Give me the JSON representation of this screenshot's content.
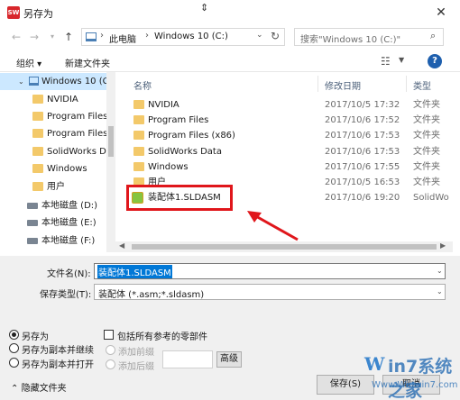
{
  "window": {
    "title": "另存为",
    "app_logo": "SW"
  },
  "nav": {
    "crumbs": [
      "此电脑",
      "Windows 10 (C:)"
    ],
    "search_placeholder": "搜索\"Windows 10 (C:)\""
  },
  "toolbar": {
    "organize": "组织 ▾",
    "new_folder": "新建文件夹"
  },
  "navpane": {
    "root": "Windows 10 (C",
    "items": [
      "NVIDIA",
      "Program Files",
      "Program Files",
      "SolidWorks D",
      "Windows",
      "用户"
    ],
    "drives": [
      "本地磁盘 (D:)",
      "本地磁盘 (E:)",
      "本地磁盘 (F:)"
    ]
  },
  "filelist": {
    "headers": {
      "name": "名称",
      "date": "修改日期",
      "type": "类型"
    },
    "rows": [
      {
        "name": "NVIDIA",
        "date": "2017/10/5 17:32",
        "type": "文件夹"
      },
      {
        "name": "Program Files",
        "date": "2017/10/6 17:52",
        "type": "文件夹"
      },
      {
        "name": "Program Files (x86)",
        "date": "2017/10/6 17:53",
        "type": "文件夹"
      },
      {
        "name": "SolidWorks Data",
        "date": "2017/10/6 17:53",
        "type": "文件夹"
      },
      {
        "name": "Windows",
        "date": "2017/10/6 17:55",
        "type": "文件夹"
      },
      {
        "name": "用户",
        "date": "2017/10/5 16:53",
        "type": "文件夹"
      },
      {
        "name": "装配体1.SLDASM",
        "date": "2017/10/6 19:20",
        "type": "SolidWo"
      }
    ]
  },
  "form": {
    "filename_label": "文件名(N):",
    "filename_value": "装配体1.SLDASM",
    "type_label": "保存类型(T):",
    "type_value": "装配体 (*.asm;*.sldasm)",
    "save_as": "另存为",
    "save_as_copy_continue": "另存为副本并继续",
    "save_as_copy_open": "另存为副本并打开",
    "include_refs": "包括所有参考的零部件",
    "add_prefix": "添加前缀",
    "add_suffix": "添加后缀",
    "advanced": "高级",
    "hide_folders": "隐藏文件夹",
    "save": "保存(S)",
    "cancel": "取消"
  },
  "watermark": {
    "logo": "W",
    "text": "in7系统之家",
    "url": "Www.Winwin7.com"
  },
  "colors": {
    "highlight": "#e0161b",
    "selection": "#0078d7",
    "accent": "#1e5fae"
  }
}
